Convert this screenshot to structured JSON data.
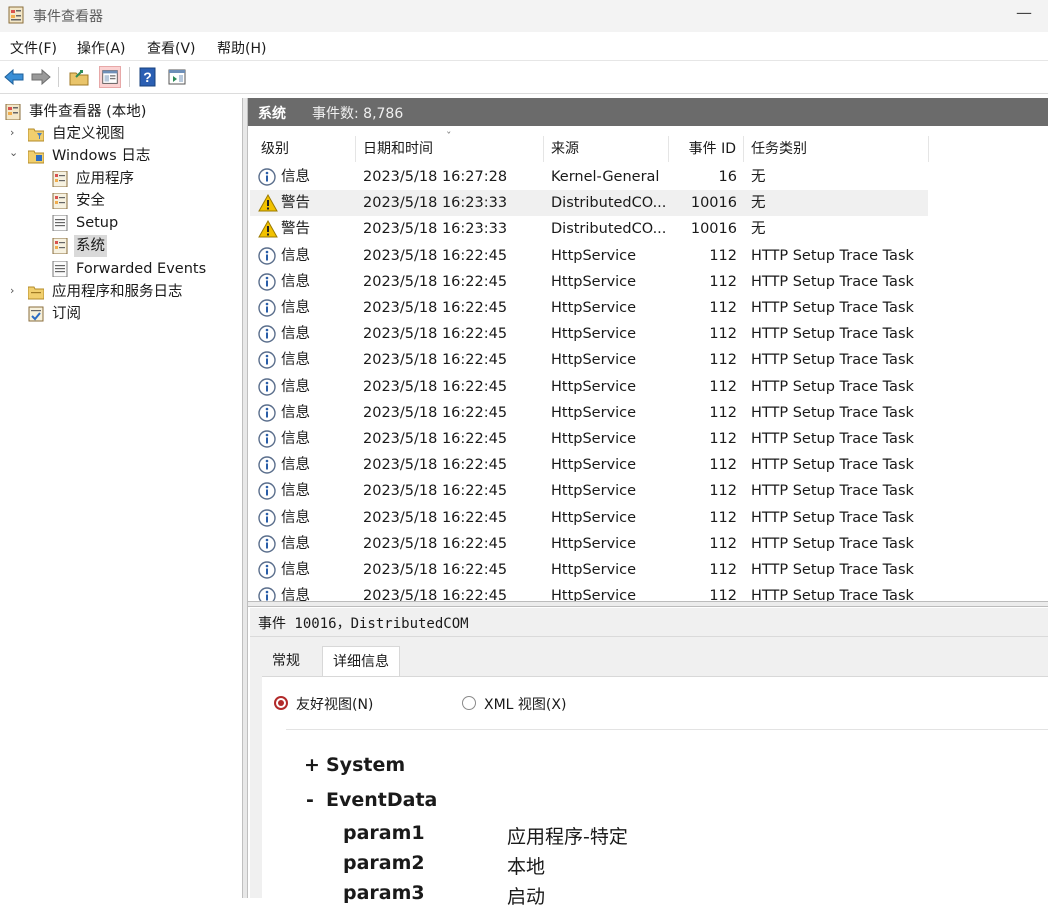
{
  "window": {
    "title": "事件查看器",
    "minimize_glyph": "—"
  },
  "menu": [
    "文件(F)",
    "操作(A)",
    "查看(V)",
    "帮助(H)"
  ],
  "tree": {
    "root": "事件查看器 (本地)",
    "custom_views": "自定义视图",
    "windows_logs": "Windows 日志",
    "logs": [
      "应用程序",
      "安全",
      "Setup",
      "系统",
      "Forwarded Events"
    ],
    "app_service_logs": "应用程序和服务日志",
    "subscriptions": "订阅",
    "expander_collapsed": "›",
    "expander_expanded": "⌄"
  },
  "header": {
    "title": "系统",
    "count_label": "事件数: 8,786"
  },
  "table": {
    "columns": [
      "级别",
      "日期和时间",
      "来源",
      "事件 ID",
      "任务类别"
    ],
    "sort_glyph": "ˇ",
    "rows": [
      {
        "level": "信息",
        "icon": "info",
        "dt": "2023/5/18 16:27:28",
        "src": "Kernel-General",
        "id": "16",
        "task": "无"
      },
      {
        "level": "警告",
        "icon": "warning",
        "dt": "2023/5/18 16:23:33",
        "src": "DistributedCO...",
        "id": "10016",
        "task": "无"
      },
      {
        "level": "警告",
        "icon": "warning",
        "dt": "2023/5/18 16:23:33",
        "src": "DistributedCO...",
        "id": "10016",
        "task": "无"
      },
      {
        "level": "信息",
        "icon": "info",
        "dt": "2023/5/18 16:22:45",
        "src": "HttpService",
        "id": "112",
        "task": "HTTP Setup Trace Task"
      },
      {
        "level": "信息",
        "icon": "info",
        "dt": "2023/5/18 16:22:45",
        "src": "HttpService",
        "id": "112",
        "task": "HTTP Setup Trace Task"
      },
      {
        "level": "信息",
        "icon": "info",
        "dt": "2023/5/18 16:22:45",
        "src": "HttpService",
        "id": "112",
        "task": "HTTP Setup Trace Task"
      },
      {
        "level": "信息",
        "icon": "info",
        "dt": "2023/5/18 16:22:45",
        "src": "HttpService",
        "id": "112",
        "task": "HTTP Setup Trace Task"
      },
      {
        "level": "信息",
        "icon": "info",
        "dt": "2023/5/18 16:22:45",
        "src": "HttpService",
        "id": "112",
        "task": "HTTP Setup Trace Task"
      },
      {
        "level": "信息",
        "icon": "info",
        "dt": "2023/5/18 16:22:45",
        "src": "HttpService",
        "id": "112",
        "task": "HTTP Setup Trace Task"
      },
      {
        "level": "信息",
        "icon": "info",
        "dt": "2023/5/18 16:22:45",
        "src": "HttpService",
        "id": "112",
        "task": "HTTP Setup Trace Task"
      },
      {
        "level": "信息",
        "icon": "info",
        "dt": "2023/5/18 16:22:45",
        "src": "HttpService",
        "id": "112",
        "task": "HTTP Setup Trace Task"
      },
      {
        "level": "信息",
        "icon": "info",
        "dt": "2023/5/18 16:22:45",
        "src": "HttpService",
        "id": "112",
        "task": "HTTP Setup Trace Task"
      },
      {
        "level": "信息",
        "icon": "info",
        "dt": "2023/5/18 16:22:45",
        "src": "HttpService",
        "id": "112",
        "task": "HTTP Setup Trace Task"
      },
      {
        "level": "信息",
        "icon": "info",
        "dt": "2023/5/18 16:22:45",
        "src": "HttpService",
        "id": "112",
        "task": "HTTP Setup Trace Task"
      },
      {
        "level": "信息",
        "icon": "info",
        "dt": "2023/5/18 16:22:45",
        "src": "HttpService",
        "id": "112",
        "task": "HTTP Setup Trace Task"
      },
      {
        "level": "信息",
        "icon": "info",
        "dt": "2023/5/18 16:22:45",
        "src": "HttpService",
        "id": "112",
        "task": "HTTP Setup Trace Task"
      },
      {
        "level": "信息",
        "icon": "info",
        "dt": "2023/5/18 16:22:45",
        "src": "HttpService",
        "id": "112",
        "task": "HTTP Setup Trace Task"
      }
    ]
  },
  "detail": {
    "title": "事件 10016，DistributedCOM",
    "tabs": [
      "常规",
      "详细信息"
    ],
    "active_tab": "详细信息",
    "radio_friendly": "友好视图(N)",
    "radio_xml": "XML 视图(X)",
    "system": {
      "sign": "+",
      "label": "System"
    },
    "eventdata": {
      "sign": "-",
      "label": "EventData"
    },
    "params": [
      {
        "name": "param1",
        "value": "应用程序-特定"
      },
      {
        "name": "param2",
        "value": "本地"
      },
      {
        "name": "param3",
        "value": "启动"
      }
    ]
  },
  "colors": {
    "accent_red": "#b22a2a",
    "header_gray": "#6b6b6b",
    "info_blue": "#2a5ea8",
    "warning_yellow": "#f2c200"
  }
}
